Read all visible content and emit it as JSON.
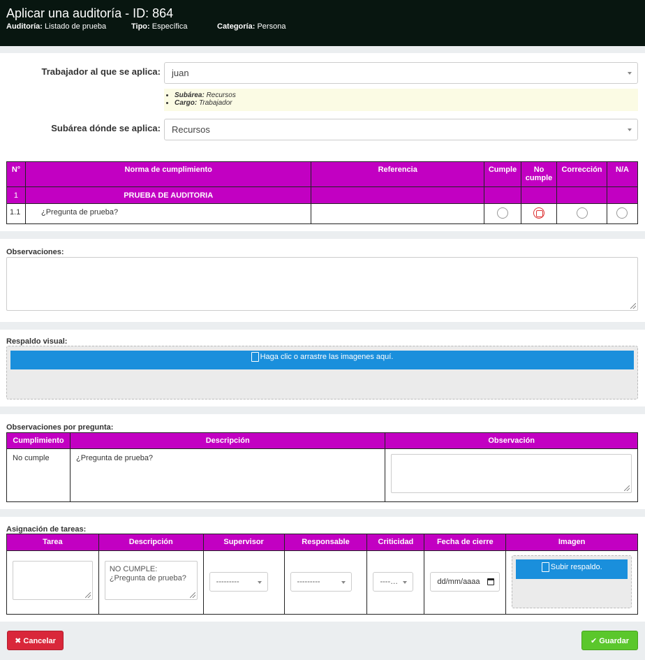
{
  "header": {
    "title": "Aplicar una auditoría - ID: 864",
    "auditoria_label": "Auditoría:",
    "auditoria_value": "Listado de prueba",
    "tipo_label": "Tipo:",
    "tipo_value": "Específica",
    "categoria_label": "Categoría:",
    "categoria_value": "Persona"
  },
  "form": {
    "trabajador_label": "Trabajador al que se aplica:",
    "trabajador_value": "juan",
    "info_subarea_label": "Subárea:",
    "info_subarea_value": "Recursos",
    "info_cargo_label": "Cargo:",
    "info_cargo_value": "Trabajador",
    "subarea_label": "Subárea dónde se aplica:",
    "subarea_value": "Recursos"
  },
  "audit_table": {
    "headers": {
      "num": "N°",
      "norma": "Norma de cumplimiento",
      "referencia": "Referencia",
      "cumple": "Cumple",
      "no_cumple": "No cumple",
      "correccion": "Corrección",
      "na": "N/A"
    },
    "group": {
      "num": "1",
      "title": "PRUEBA DE AUDITORIA"
    },
    "row": {
      "num": "1.1",
      "question": "¿Pregunta de prueba?",
      "selected": "no_cumple"
    }
  },
  "observaciones": {
    "label": "Observaciones:"
  },
  "respaldo": {
    "label": "Respaldo visual:",
    "dropzone_text": "Haga clic o arrastre las imagenes aquí."
  },
  "obs_pregunta": {
    "label": "Observaciones por pregunta:",
    "headers": {
      "cumplimiento": "Cumplimiento",
      "descripcion": "Descripción",
      "observacion": "Observación"
    },
    "row": {
      "cumplimiento": "No cumple",
      "descripcion": "¿Pregunta de prueba?"
    }
  },
  "tareas": {
    "label": "Asignación de tareas:",
    "headers": {
      "tarea": "Tarea",
      "descripcion": "Descripción",
      "supervisor": "Supervisor",
      "responsable": "Responsable",
      "criticidad": "Criticidad",
      "fecha": "Fecha de cierre",
      "imagen": "Imagen"
    },
    "row": {
      "descripcion_line1": "NO CUMPLE:",
      "descripcion_line2": "¿Pregunta de prueba?",
      "supervisor": "---------",
      "responsable": "---------",
      "criticidad": "----…",
      "fecha_placeholder": "dd/mm/aaaa",
      "imagen_button": "Subir respaldo."
    }
  },
  "actions": {
    "cancel": "Cancelar",
    "save": "Guardar"
  },
  "colors": {
    "header_bg": "#081610",
    "table_header": "#c200c2",
    "primary": "#1a8fdc",
    "danger": "#d9273a",
    "success": "#5bc72c"
  }
}
